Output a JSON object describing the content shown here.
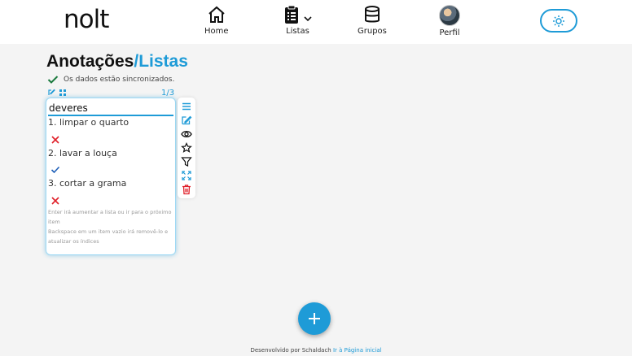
{
  "header": {
    "logo": "nolt",
    "nav": [
      {
        "label": "Home",
        "icon": "home-icon"
      },
      {
        "label": "Listas",
        "icon": "clipboard-list-icon"
      },
      {
        "label": "Grupos",
        "icon": "database-icon"
      },
      {
        "label": "Perfil",
        "icon": "avatar"
      }
    ],
    "theme_toggle_icon": "sun-icon"
  },
  "page": {
    "title_part1": "Anotações",
    "title_part2": "/Listas",
    "sync_status": "Os dados estão sincronizados.",
    "counter": "1/3"
  },
  "card": {
    "title": "deveres",
    "items": [
      {
        "text": "1. limpar o quarto",
        "status": "remove-icon"
      },
      {
        "text": "2. lavar a louça",
        "status": "check-icon"
      },
      {
        "text": "3. cortar a grama",
        "status": "remove-icon"
      }
    ],
    "hint_line1": "Enter irá aumentar a lista ou ir para o próximo item",
    "hint_line2": "Backspace em um item vazio irá removê-lo e atualizar os índices"
  },
  "side_actions": [
    "menu-icon",
    "edit-icon",
    "eye-icon",
    "star-icon",
    "filter-icon",
    "expand-icon",
    "trash-icon"
  ],
  "footer": {
    "text": "Desenvolvido por Schaldach",
    "link": "Ir à Página inicial"
  },
  "colors": {
    "accent": "#1e9bd7",
    "check": "#1b7a3e",
    "remove": "#e0202a"
  }
}
